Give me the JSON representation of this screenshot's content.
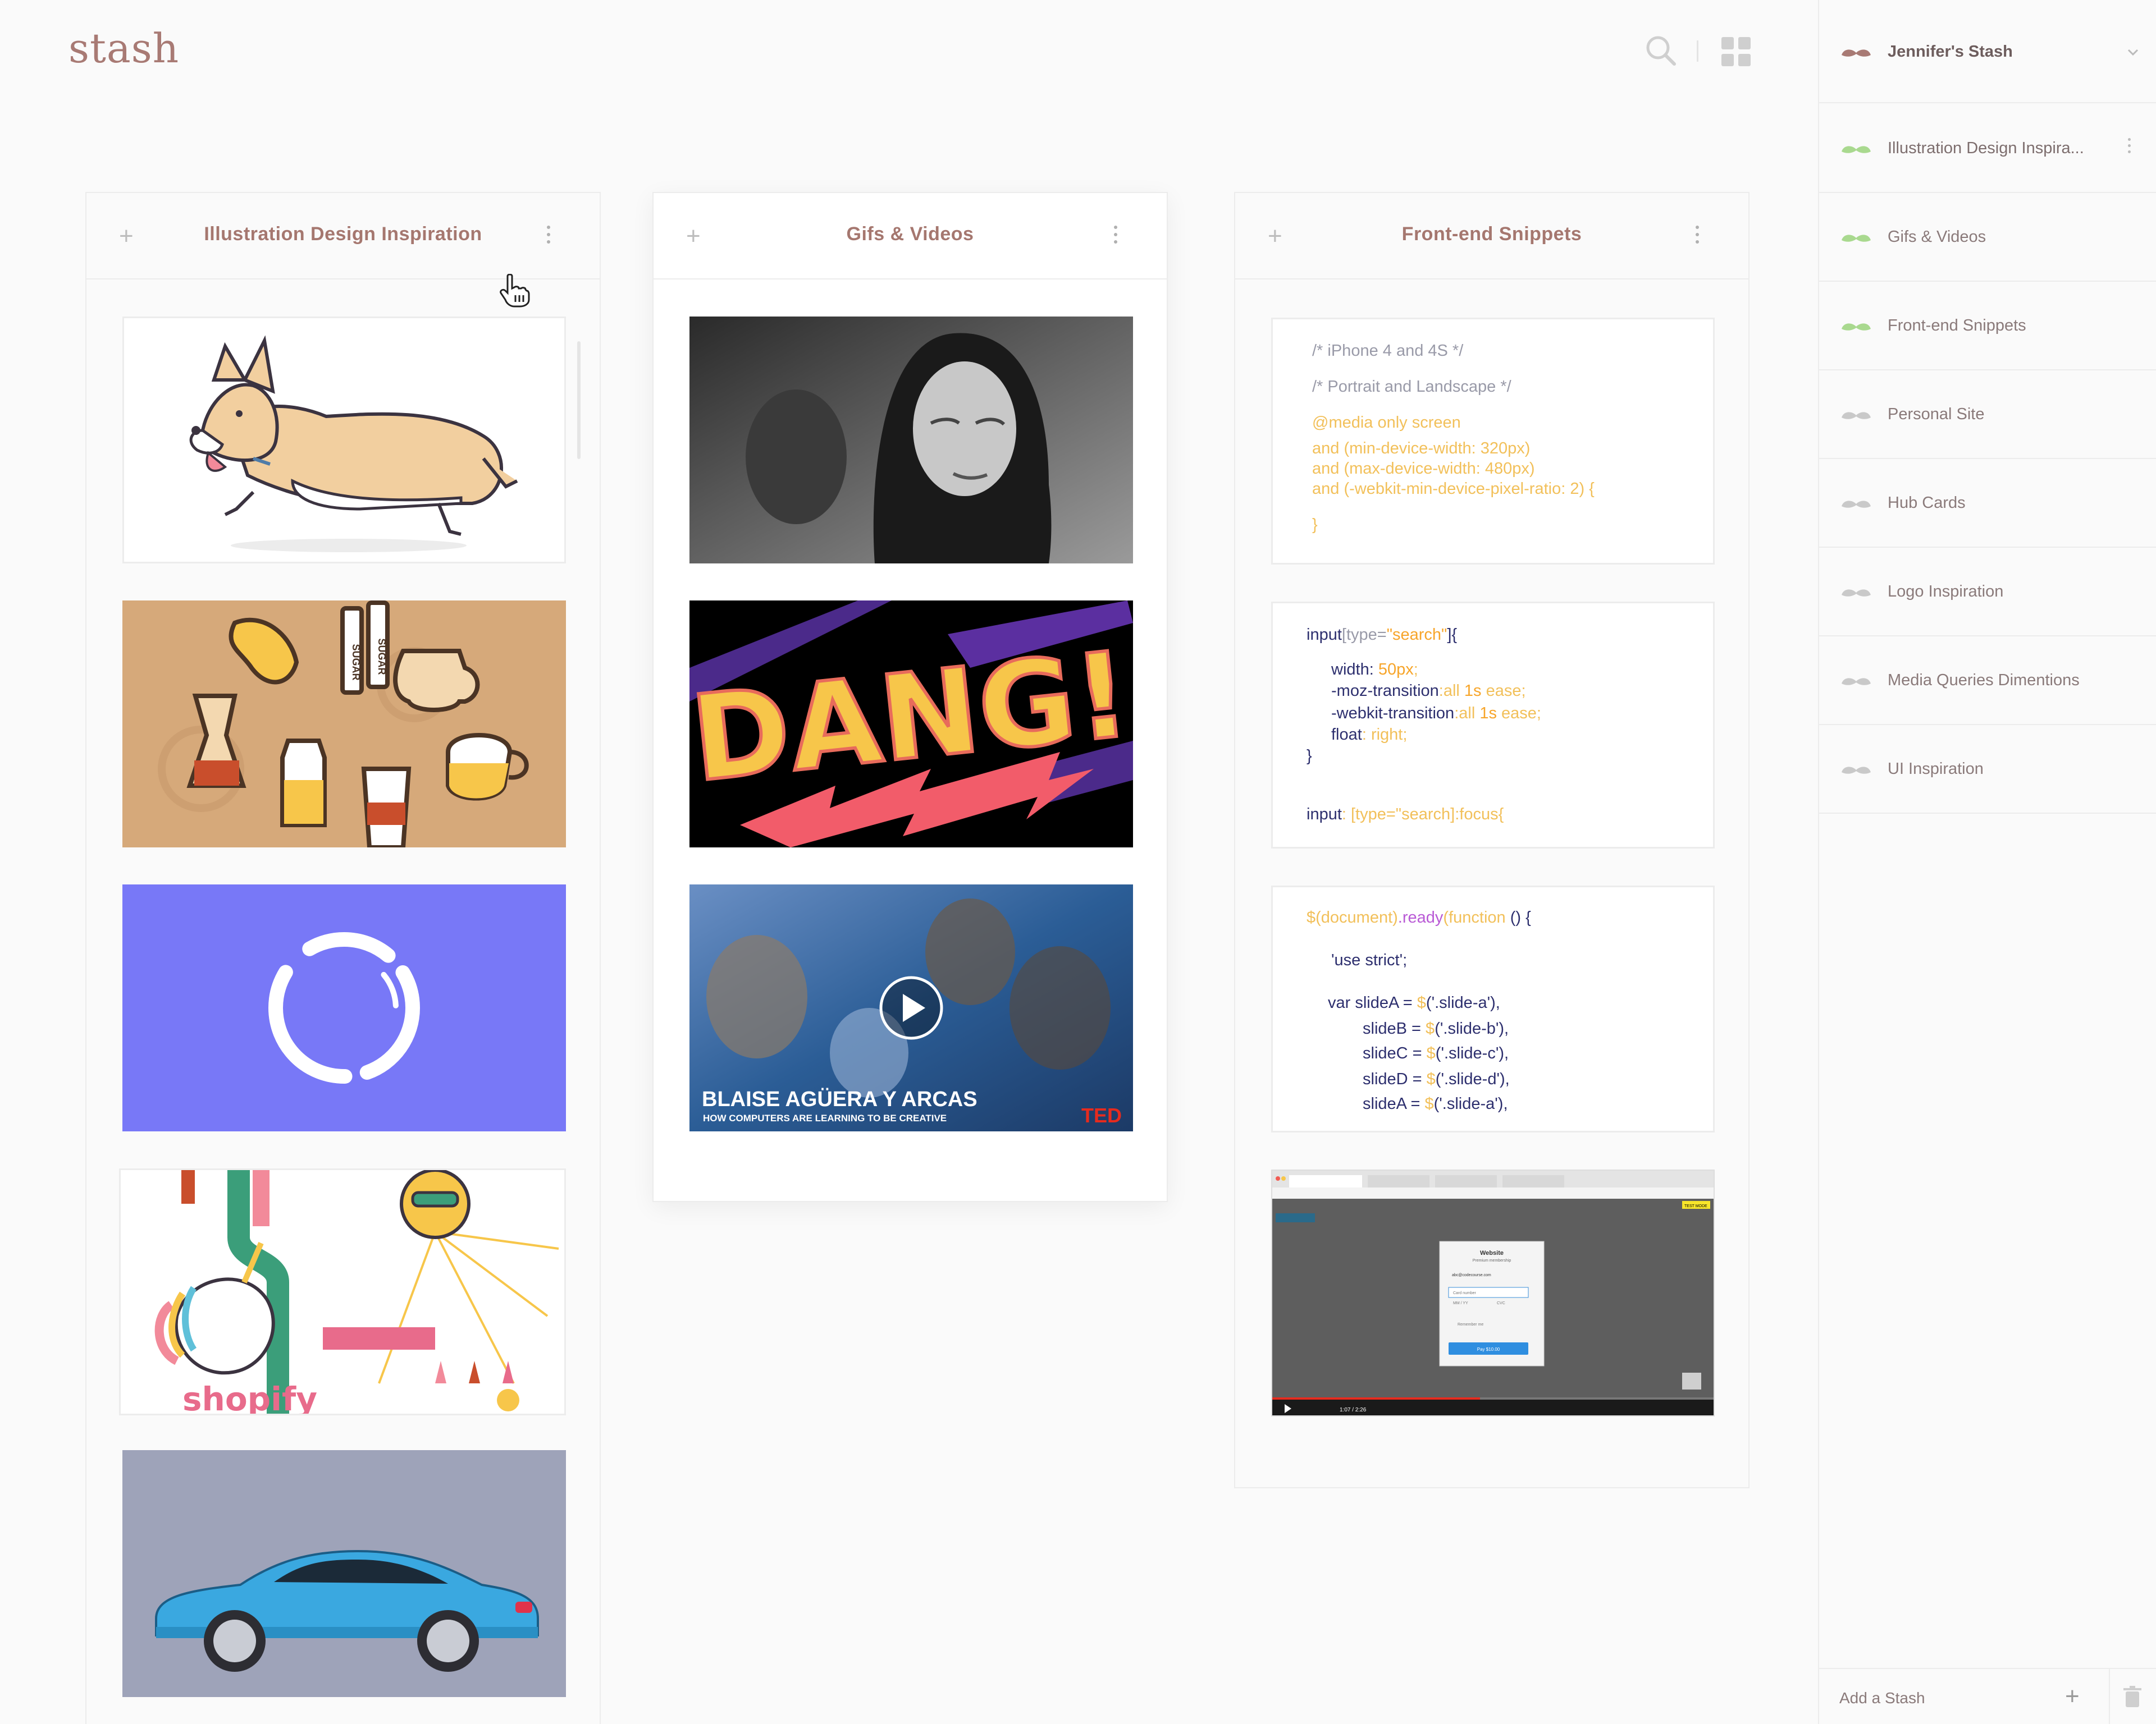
{
  "app": {
    "logo": "stash"
  },
  "header": {
    "search_icon": "search-icon",
    "grid_icon": "grid-view-icon"
  },
  "columns": [
    {
      "title": "Illustration Design Inspiration"
    },
    {
      "title": "Gifs & Videos"
    },
    {
      "title": "Front-end Snippets"
    }
  ],
  "gifs": {
    "dang_text": "DANG!",
    "ted_title": "BLAISE AGÜERA Y ARCAS",
    "ted_subtitle": "HOW COMPUTERS ARE LEARNING TO BE CREATIVE",
    "ted_logo": "TED"
  },
  "illustrations": {
    "shopify_text": "shopify",
    "sugar_label": "SUGAR"
  },
  "snippets": {
    "s1": [
      "/* iPhone 4 and 4S */",
      "/* Portrait and Landscape */",
      "@media only screen",
      "and (min-device-width: 320px)",
      "and (max-device-width: 480px)",
      "and (-webkit-min-device-pixel-ratio: 2) {",
      "}"
    ],
    "s2": {
      "l1a": "input",
      "l1b": "[type=",
      "l1c": "\"search\"",
      "l1d": "]{",
      "l2a": "width",
      "l2b": ": ",
      "l2c": "50px",
      "l2d": ";",
      "l3a": "-moz-transition",
      "l3b": ":all ",
      "l3c": "1s",
      "l3d": " ease;",
      "l4a": "-webkit-transition",
      "l4b": ":all ",
      "l4c": "1s",
      "l4d": " ease;",
      "l5a": "float",
      "l5b": ": right;",
      "l6": "}",
      "l7a": "input",
      "l7b": ": [type=\"search]:focus{"
    },
    "s3": {
      "l1a": "$",
      "l1b": "(document)",
      "l1c": ".ready",
      "l1d": "(function",
      "l1e": " () {",
      "l2": "'use strict';",
      "l3a": "var slideA = ",
      "l3b": "$",
      "l3c": "('.slide-a'),",
      "l4a": "slideB = ",
      "l4b": "$",
      "l4c": "('.slide-b'),",
      "l5a": "slideC = ",
      "l5b": "$",
      "l5c": "('.slide-c'),",
      "l6a": "slideD = ",
      "l6b": "$",
      "l6c": "('.slide-d'),",
      "l7a": "slideA = ",
      "l7b": "$",
      "l7c": "('.slide-a'),"
    }
  },
  "video_screenshot": {
    "modal_title": "Website",
    "modal_sub": "Premium membership",
    "email": "abc@codecourse.com",
    "card_number": "Card number",
    "expiry": "MM / YY",
    "cvc": "CVC",
    "remember": "Remember me",
    "pay_button": "Pay $10.00",
    "time": "1:07 / 2:26",
    "test_mode": "TEST MODE"
  },
  "sidebar": {
    "header": "Jennifer's Stash",
    "items": [
      {
        "label": "Illustration Design Inspira...",
        "color": "#a9d98f"
      },
      {
        "label": "Gifs & Videos",
        "color": "#a9d98f"
      },
      {
        "label": "Front-end Snippets",
        "color": "#a9d98f"
      },
      {
        "label": "Personal Site",
        "color": "#c9c9c9"
      },
      {
        "label": "Hub Cards",
        "color": "#c9c9c9"
      },
      {
        "label": "Logo Inspiration",
        "color": "#c9c9c9"
      },
      {
        "label": "Media Queries Dimentions",
        "color": "#c9c9c9"
      },
      {
        "label": "UI Inspiration",
        "color": "#c9c9c9"
      }
    ],
    "add_label": "Add a Stash"
  },
  "colors": {
    "brand": "#a87a74",
    "accent_purple": "#7878f7",
    "coffee_bg": "#d6a97a",
    "car_bg": "#9ea3b9"
  }
}
